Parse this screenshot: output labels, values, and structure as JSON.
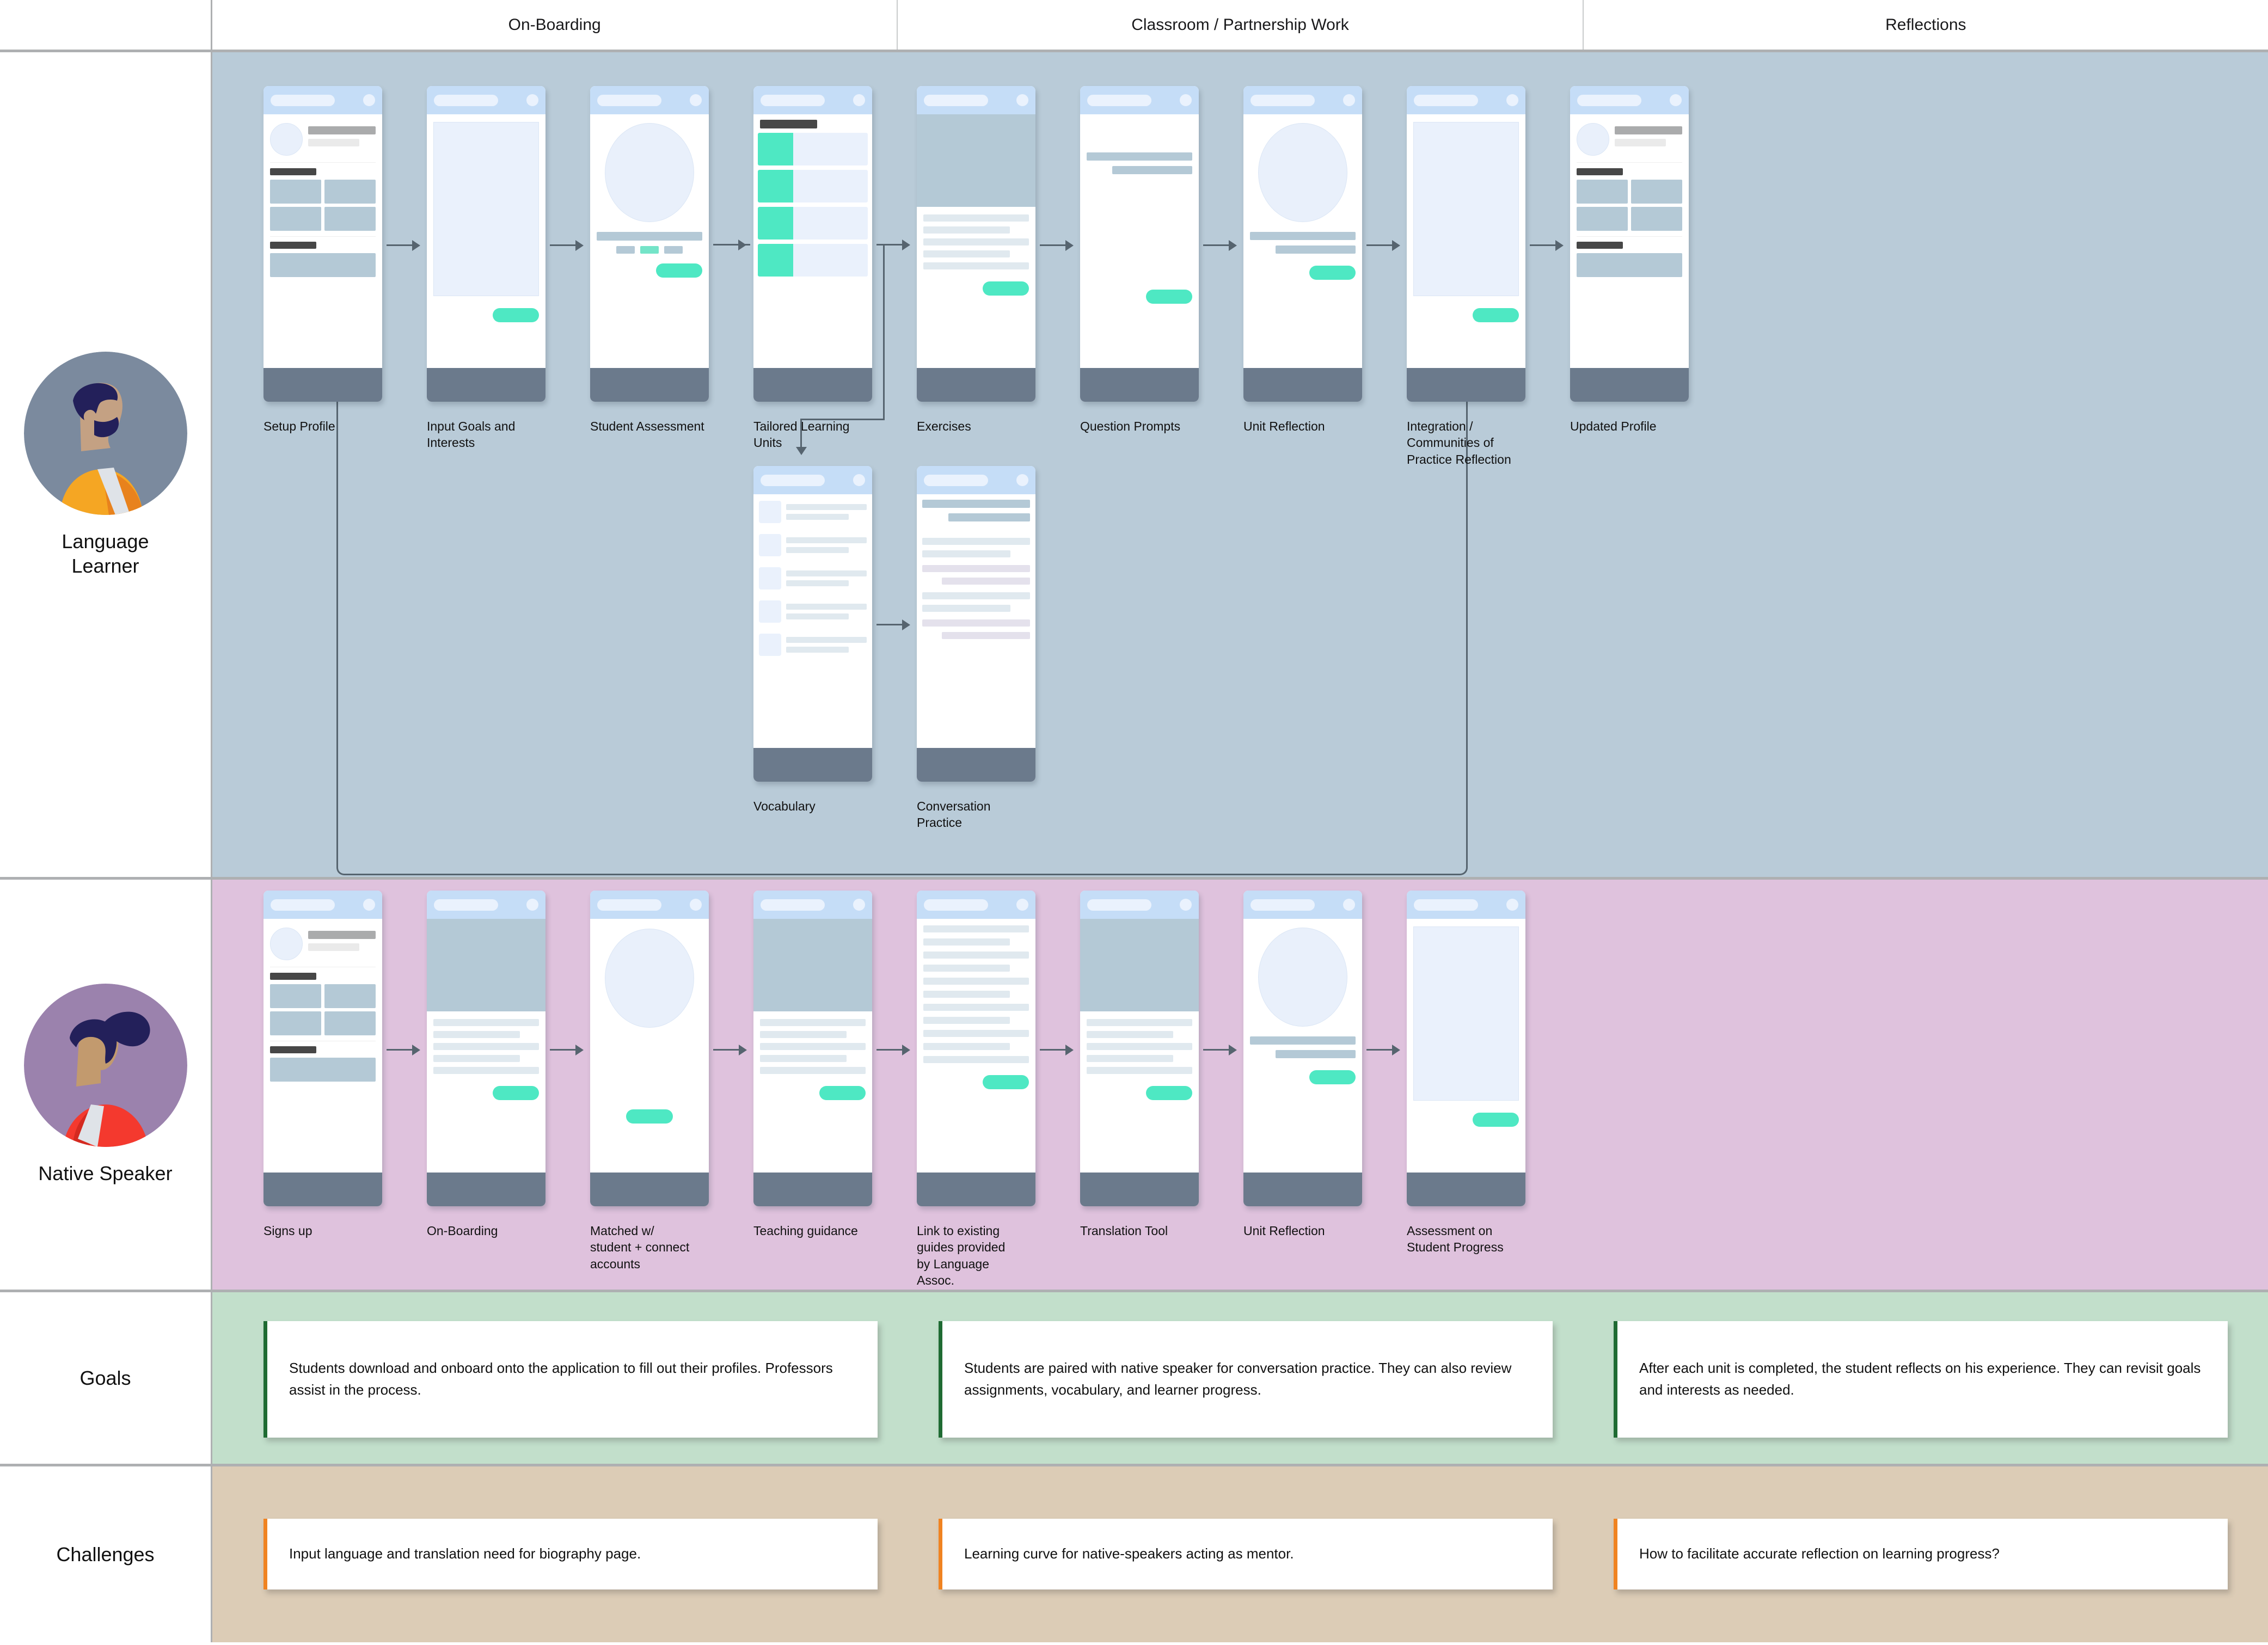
{
  "columns": [
    {
      "label": "On-Boarding"
    },
    {
      "label": "Classroom / Partnership Work"
    },
    {
      "label": "Reflections"
    }
  ],
  "personas": [
    {
      "name_line1": "Language",
      "name_line2": "Learner",
      "avatar": "language-learner-avatar",
      "lane_color": "#b9cbd8"
    },
    {
      "name_line1": "Native Speaker",
      "name_line2": "",
      "avatar": "native-speaker-avatar",
      "lane_color": "#dfc2dd"
    }
  ],
  "sections": [
    {
      "label": "Goals",
      "lane_color": "#c2dfcb",
      "accent": "#1f6b33"
    },
    {
      "label": "Challenges",
      "lane_color": "#dcccb6",
      "accent": "#f08321"
    }
  ],
  "learner_flow": {
    "main": [
      {
        "caption": "Setup Profile",
        "screen": "profile"
      },
      {
        "caption": "Input Goals and Interests",
        "screen": "bigbox"
      },
      {
        "caption": "Student Assessment",
        "screen": "assessment"
      },
      {
        "caption": "Tailored Learning Units",
        "screen": "units"
      },
      {
        "caption": "Exercises",
        "screen": "hero-list"
      },
      {
        "caption": "Question Prompts",
        "screen": "prompts"
      },
      {
        "caption": "Unit Reflection",
        "screen": "reflection"
      },
      {
        "caption": "Integration / Communities of Practice Reflection",
        "screen": "bigbox"
      },
      {
        "caption": "Updated Profile",
        "screen": "profile"
      }
    ],
    "branch": [
      {
        "caption": "Vocabulary",
        "screen": "vocab"
      },
      {
        "caption": "Conversation Practice",
        "screen": "conversation"
      }
    ]
  },
  "native_flow": [
    {
      "caption": "Signs up",
      "screen": "profile"
    },
    {
      "caption": "On-Boarding",
      "screen": "hero-list"
    },
    {
      "caption": "Matched w/ student + connect accounts",
      "screen": "matched"
    },
    {
      "caption": "Teaching guidance",
      "screen": "hero-list"
    },
    {
      "caption": "Link to existing guides provided by Language Assoc.",
      "screen": "longlist"
    },
    {
      "caption": "Translation Tool",
      "screen": "hero-list"
    },
    {
      "caption": "Unit Reflection",
      "screen": "reflection"
    },
    {
      "caption": "Assessment on Student Progress",
      "screen": "bigbox"
    }
  ],
  "goals": [
    "Students download and onboard onto the application to fill out their profiles. Professors assist in the process.",
    "Students are paired with native speaker for conversation practice. They can also review assignments, vocabulary, and learner progress.",
    "After each unit is completed, the student reflects on his experience. They can revisit goals and interests as needed."
  ],
  "challenges": [
    "Input language and translation need for biography page.",
    "Learning curve for native-speakers acting as mentor.",
    "How to facilitate accurate reflection on learning progress?"
  ],
  "colors": {
    "teal_accent": "#4ee8c3",
    "appbar": "#c5ddf7",
    "navbar": "#6b7a8c",
    "wire_bar": "#b4c9d6",
    "learner_lane": "#b9cbd8",
    "native_lane": "#dfc2dd",
    "goals_lane": "#c2dfcb",
    "challenges_lane": "#dcccb6",
    "goal_accent": "#1f6b33",
    "challenge_accent": "#f08321",
    "connector": "#56646f"
  }
}
